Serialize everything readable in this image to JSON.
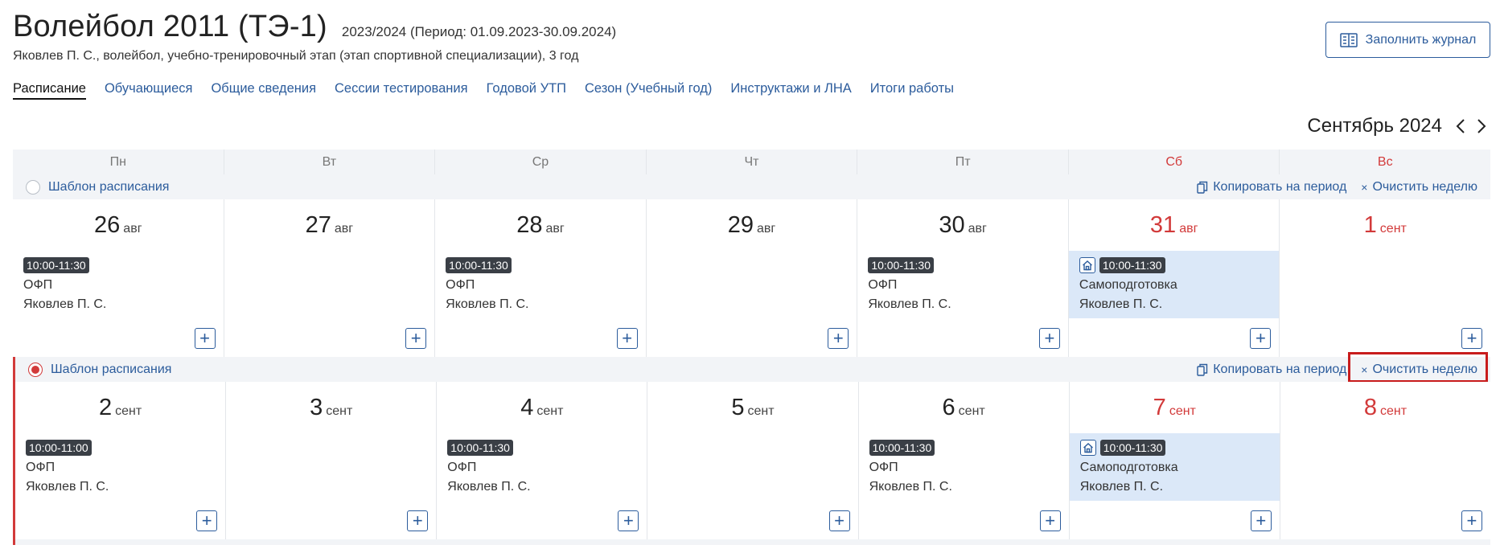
{
  "header": {
    "title": "Волейбол 2011 (ТЭ-1)",
    "period": "2023/2024 (Период: 01.09.2023-30.09.2024)",
    "subtitle": "Яковлев П. С., волейбол, учебно-тренировочный этап (этап спортивной специализации), 3 год",
    "fill_journal_label": "Заполнить журнал"
  },
  "tabs": [
    {
      "label": "Расписание",
      "active": true
    },
    {
      "label": "Обучающиеся"
    },
    {
      "label": "Общие сведения"
    },
    {
      "label": "Сессии тестирования"
    },
    {
      "label": "Годовой УТП"
    },
    {
      "label": "Сезон (Учебный год)"
    },
    {
      "label": "Инструктажи и ЛНА"
    },
    {
      "label": "Итоги работы"
    }
  ],
  "calendar": {
    "month_label": "Сентябрь 2024",
    "weekdays": [
      "Пн",
      "Вт",
      "Ср",
      "Чт",
      "Пт",
      "Сб",
      "Вс"
    ],
    "template_label": "Шаблон расписания",
    "copy_label": "Копировать на период",
    "clear_label": "Очистить неделю",
    "clear_x": "×",
    "add_symbol": "+",
    "weeks": [
      {
        "days": [
          {
            "num": "26",
            "mon": "авг",
            "event": {
              "time": "10:00-11:30",
              "name": "ОФП",
              "coach": "Яковлев П. С."
            }
          },
          {
            "num": "27",
            "mon": "авг"
          },
          {
            "num": "28",
            "mon": "авг",
            "event": {
              "time": "10:00-11:30",
              "name": "ОФП",
              "coach": "Яковлев П. С."
            }
          },
          {
            "num": "29",
            "mon": "авг"
          },
          {
            "num": "30",
            "mon": "авг",
            "event": {
              "time": "10:00-11:30",
              "name": "ОФП",
              "coach": "Яковлев П. С."
            }
          },
          {
            "num": "31",
            "mon": "авг",
            "event": {
              "time": "10:00-11:30",
              "name": "Самоподготовка",
              "coach": "Яковлев П. С."
            }
          },
          {
            "num": "1",
            "mon": "сент"
          }
        ]
      },
      {
        "days": [
          {
            "num": "2",
            "mon": "сент",
            "event": {
              "time": "10:00-11:00",
              "name": "ОФП",
              "coach": "Яковлев П. С."
            }
          },
          {
            "num": "3",
            "mon": "сент"
          },
          {
            "num": "4",
            "mon": "сент",
            "event": {
              "time": "10:00-11:30",
              "name": "ОФП",
              "coach": "Яковлев П. С."
            }
          },
          {
            "num": "5",
            "mon": "сент"
          },
          {
            "num": "6",
            "mon": "сент",
            "event": {
              "time": "10:00-11:30",
              "name": "ОФП",
              "coach": "Яковлев П. С."
            }
          },
          {
            "num": "7",
            "mon": "сент",
            "event": {
              "time": "10:00-11:30",
              "name": "Самоподготовка",
              "coach": "Яковлев П. С."
            }
          },
          {
            "num": "8",
            "mon": "сент"
          }
        ]
      }
    ]
  },
  "colors": {
    "accent": "#2c5c9c",
    "weekend": "#d23a3a",
    "self_study_bg": "#dbe8f8",
    "highlight": "#c81c1c"
  },
  "icons": {
    "journal": "journal-icon",
    "copy": "copy-icon",
    "home": "home-icon",
    "prev": "chevron-left-icon",
    "next": "chevron-right-icon"
  }
}
